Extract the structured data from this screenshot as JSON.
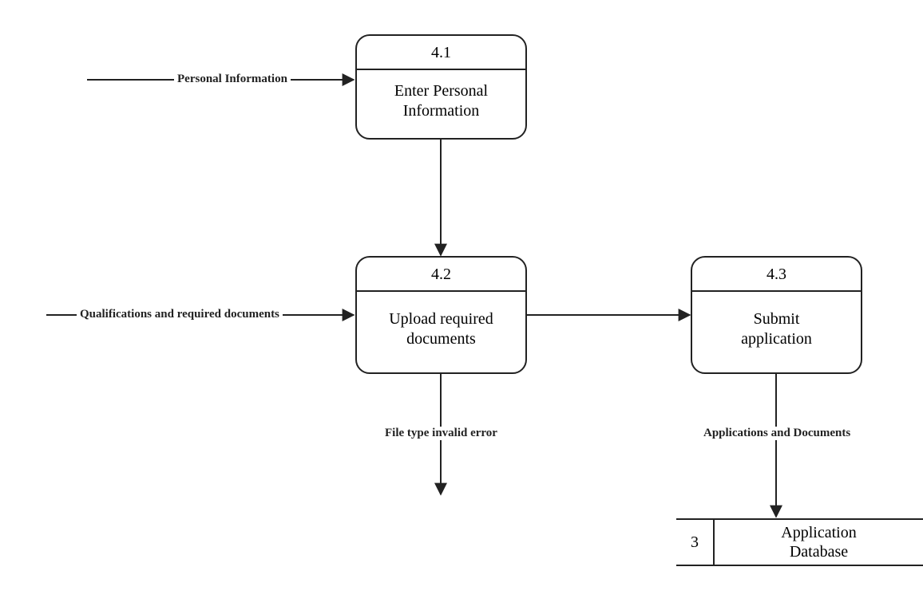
{
  "processes": {
    "p41": {
      "id": "4.1",
      "title_l1": "Enter Personal",
      "title_l2": "Information"
    },
    "p42": {
      "id": "4.2",
      "title_l1": "Upload required",
      "title_l2": "documents"
    },
    "p43": {
      "id": "4.3",
      "title_l1": "Submit",
      "title_l2": "application"
    }
  },
  "datastores": {
    "ds3": {
      "id": "3",
      "name_l1": "Application",
      "name_l2": "Database"
    }
  },
  "labels": {
    "personal_info": "Personal Information",
    "qualifications": "Qualifications and required documents",
    "file_error": "File type invalid error",
    "apps_docs": "Applications and Documents"
  }
}
